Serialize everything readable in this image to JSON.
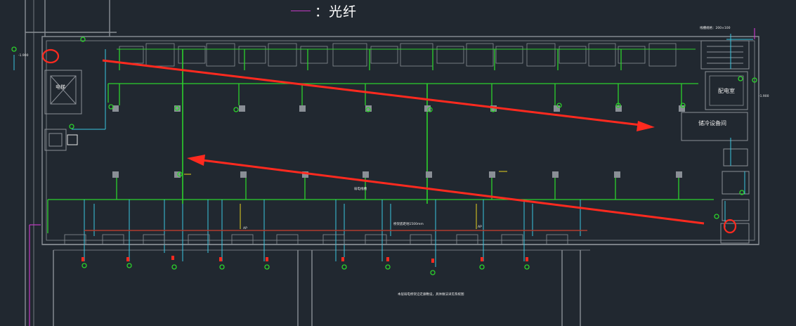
{
  "legend": {
    "label": "：光纤",
    "line_color": "#c43ac4"
  },
  "colors": {
    "background": "#212830",
    "wall": "#8a8f96",
    "bus_green": "#2cd12c",
    "cable_cyan": "#39c6e0",
    "fiber_magenta": "#c43ac4",
    "red_arrow": "#ff2a1f",
    "label_white": "#e8e8e8",
    "yellow": "#e8d21e"
  },
  "rooms": {
    "electric_room": "配电室",
    "equipment_room": "储冷设备间",
    "elevator_label": "电梯"
  },
  "annotations": {
    "top_note": "线槽规格：200×100",
    "right_level_mark": "-1.900",
    "left_level_mark": "-1.900",
    "bottom_note": "本层弱电桥架沿走廊敷设，具体做法详见系统图",
    "tray_note": "桥架底距地1500mm",
    "mid_note": "弱电线槽",
    "cabinet_a": "AP",
    "cabinet_b": "AP"
  },
  "arrows": [
    {
      "name": "upper-arrow",
      "direction": "left-to-right"
    },
    {
      "name": "lower-arrow",
      "direction": "right-to-left"
    }
  ],
  "markers": [
    {
      "name": "start-marker"
    },
    {
      "name": "end-marker"
    }
  ]
}
